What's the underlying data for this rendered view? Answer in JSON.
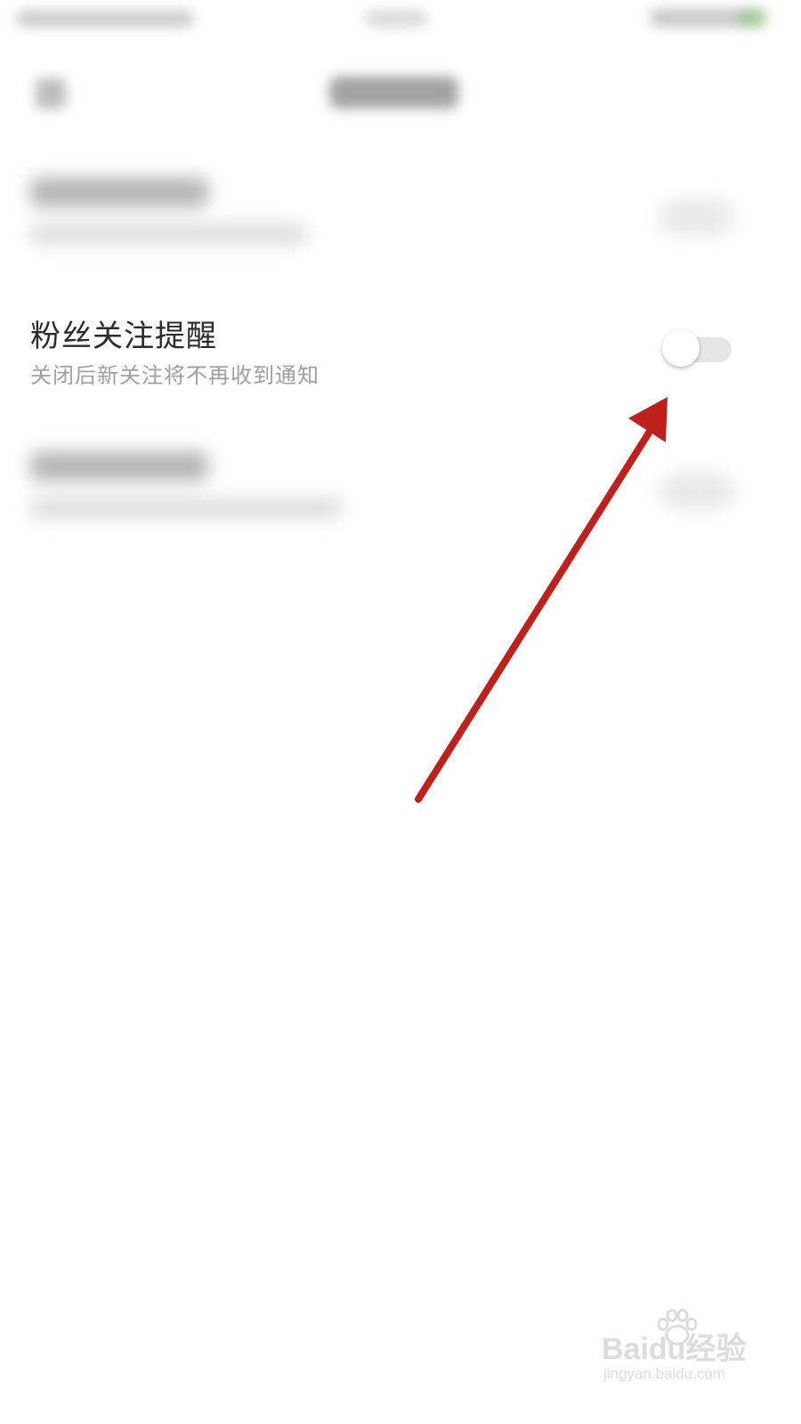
{
  "setting": {
    "title": "粉丝关注提醒",
    "subtitle": "关闭后新关注将不再收到通知",
    "toggle_on": false
  },
  "colors": {
    "arrow": "#c0201a",
    "toggle_track": "#e6e6e6",
    "subtitle": "#a0a0a0"
  },
  "watermark": {
    "logo": "Baidu经验",
    "url": "jingyan.baidu.com"
  }
}
